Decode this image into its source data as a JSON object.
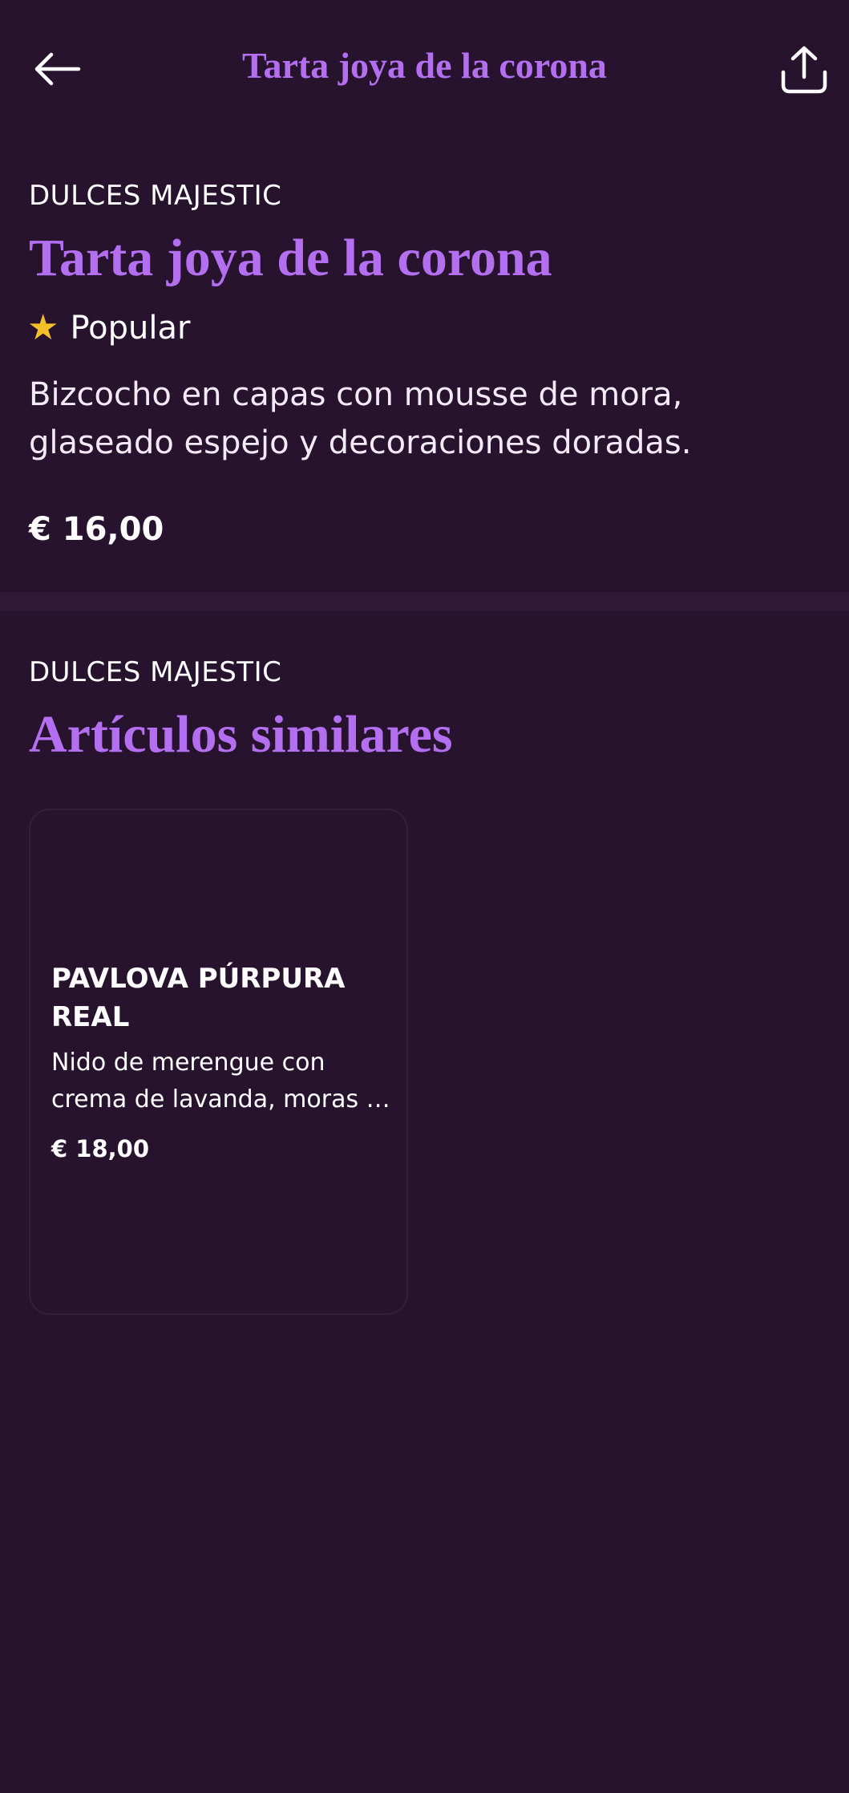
{
  "header": {
    "title": "Tarta joya de la corona",
    "back_icon": "arrow-left-icon",
    "share_icon": "share-icon"
  },
  "product": {
    "vendor": "DULCES MAJESTIC",
    "title": "Tarta joya de la corona",
    "badge_icon": "star-icon",
    "badge_label": "Popular",
    "description": "Bizcocho en capas con mousse de mora, glaseado espejo y decoraciones doradas.",
    "price": "€ 16,00"
  },
  "similar": {
    "vendor": "DULCES MAJESTIC",
    "title": "Artículos similares",
    "items": [
      {
        "name": "PAVLOVA PÚRPURA REAL",
        "description": "Nido de merengue con crema de lavanda, moras y pan de oro.",
        "price": "€ 18,00"
      }
    ]
  },
  "colors": {
    "background": "#28132f",
    "accent": "#b46ff0",
    "star": "#f4c02a",
    "divider": "#2f1838"
  }
}
